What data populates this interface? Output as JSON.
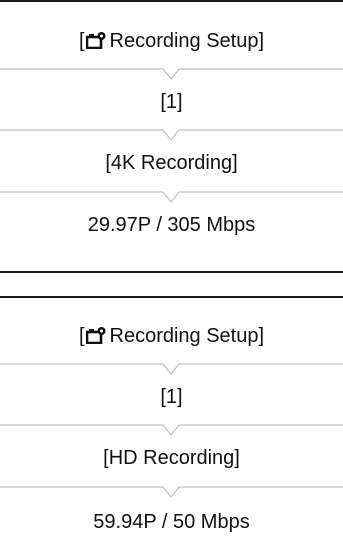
{
  "blocks": [
    {
      "steps": [
        {
          "prefix": "[",
          "icon": "camera-settings-icon",
          "label": "Recording Setup]"
        },
        {
          "label": "[1]"
        },
        {
          "label": "[4K Recording]"
        },
        {
          "label": "29.97P / 305 Mbps"
        }
      ]
    },
    {
      "steps": [
        {
          "prefix": "[",
          "icon": "camera-settings-icon",
          "label": "Recording Setup]"
        },
        {
          "label": "[1]"
        },
        {
          "label": "[HD Recording]"
        },
        {
          "label": "59.94P / 50 Mbps"
        }
      ]
    }
  ]
}
